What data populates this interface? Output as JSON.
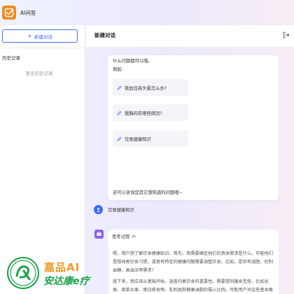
{
  "app": {
    "title": "AI问答",
    "accent": "#3f6cf5",
    "logo_color": "#f08a1d"
  },
  "sidebar": {
    "new_chat_label": "新建对话",
    "history_title": "历史记录",
    "history_empty": "暂无历史记录"
  },
  "main": {
    "title": "新建对话",
    "exit_icon": "logout-icon"
  },
  "welcome": {
    "line1": "什么问题都可以哦。",
    "line2": "例如:",
    "suggestions": [
      {
        "icon": "pencil-icon",
        "label": "我血压高头晕怎么办?"
      },
      {
        "icon": "pencil-icon",
        "label": "我胸闷有哪些原因?"
      },
      {
        "icon": "pencil-icon",
        "label": "饮食健康知识"
      }
    ],
    "footer": "还可以咨询您其它想知道的问题哦~"
  },
  "user_message": {
    "text": "饮食健康知识"
  },
  "answer": {
    "thinking_label": "思考过程",
    "thinking_paragraphs": [
      "嗯，用户想了解饮食健康知识。首先，我需要确定他们的具体需求是什么。可能他们是想改善饮食习惯，或者有特定的健康问题需要调整饮食。比如，是否有减肥、控制血糖、高血压等需求?",
      "接下来，我应该从基础开始，涵盖均衡饮食的重要性。需要提到膳食宝塔，比如谷类、蔬菜水果、蛋白质食物、乳制品和健康油脂的摄入比例。可能用户对这些基本概念不太清楚，所"
    ]
  },
  "watermark": {
    "line1": "嘉品AI",
    "line2": "安达康e疗",
    "green": "#1aa24a",
    "orange": "#f09a26"
  }
}
